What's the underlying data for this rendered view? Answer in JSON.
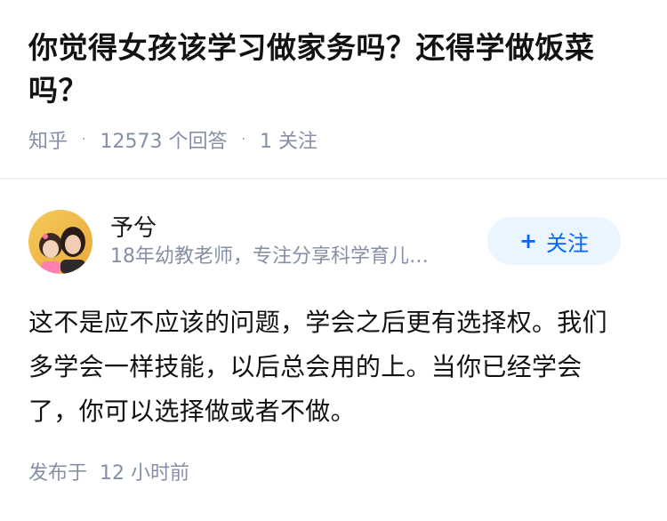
{
  "question": {
    "title": "你觉得女孩该学习做家务吗？还得学做饭菜吗？",
    "source": "知乎",
    "answer_count": "12573",
    "answer_label": "个回答",
    "follower_count": "1",
    "follower_label": "关注"
  },
  "author": {
    "name": "予兮",
    "bio": "18年幼教老师，专注分享科学育儿…",
    "avatar_icon": "avatar-photo",
    "follow_label": "关注",
    "follow_icon": "plus-icon",
    "accent_color": "#0066ff"
  },
  "answer": {
    "text": "这不是应不应该的问题，学会之后更有选择权。我们多学会一样技能，以后总会用的上。当你已经学会了，你可以选择做或者不做。",
    "published_label": "发布于",
    "published_time": "12 小时前"
  }
}
